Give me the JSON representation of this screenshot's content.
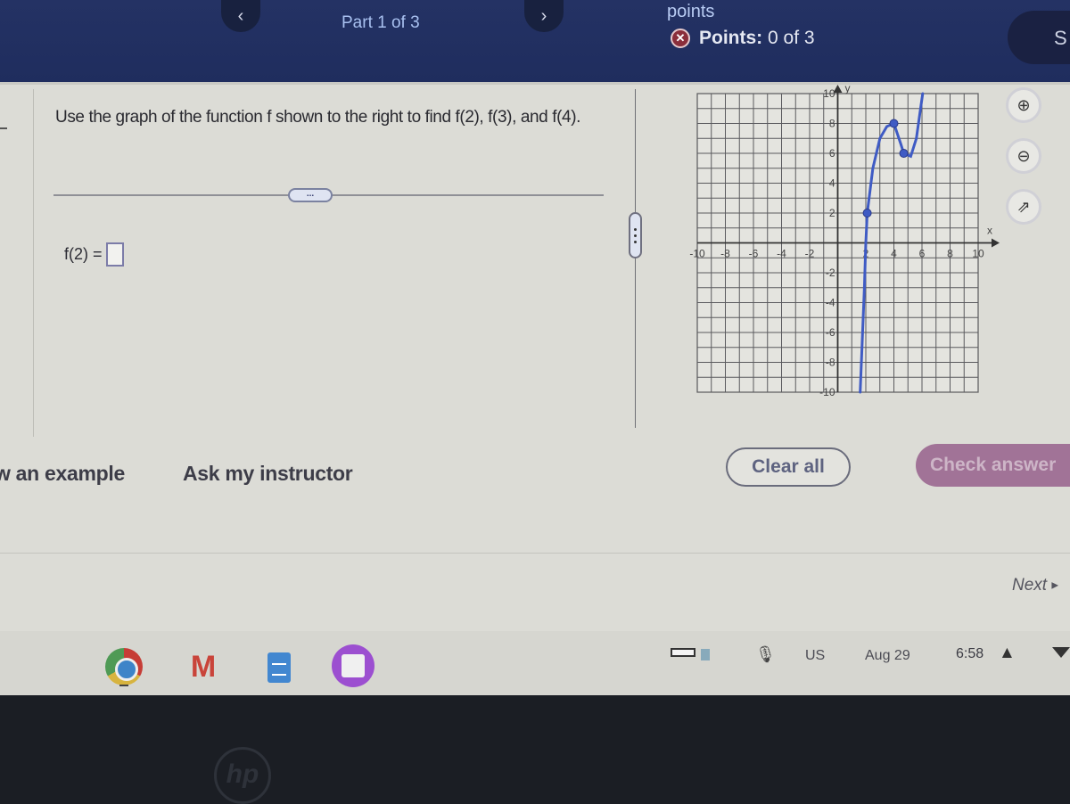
{
  "header": {
    "prev_icon": "chevron-left",
    "next_icon": "chevron-right",
    "part_label": "Part 1 of 3",
    "points_caption": "points",
    "points_status_icon": "x-circle",
    "points_label": "Points:",
    "points_value": "0 of 3",
    "save_label": "S"
  },
  "question": {
    "text": "Use the graph of the function f shown to the right to find f(2), f(3), and f(4).",
    "more_label": "...",
    "answer_label": "f(2) =",
    "answer_value": ""
  },
  "graph": {
    "x_label": "x",
    "y_label": "y",
    "x_ticks": [
      "-10",
      "-8",
      "-6",
      "-4",
      "-2",
      "2",
      "4",
      "6",
      "8",
      "10"
    ],
    "y_ticks": [
      "10",
      "8",
      "6",
      "4",
      "2",
      "-2",
      "-4",
      "-6",
      "-8",
      "-10"
    ],
    "x_range": [
      -10,
      10
    ],
    "y_range": [
      -10,
      10
    ],
    "curve_color": "#3f5bc4",
    "curve_points": [
      [
        1.6,
        -10
      ],
      [
        1.9,
        -3
      ],
      [
        2,
        0
      ],
      [
        2.1,
        2
      ],
      [
        2.5,
        5
      ],
      [
        3,
        7
      ],
      [
        3.5,
        7.8
      ],
      [
        4,
        8
      ],
      [
        4.5,
        6.6
      ],
      [
        4.7,
        6
      ],
      [
        5.2,
        5.8
      ],
      [
        5.6,
        7
      ],
      [
        5.9,
        9
      ],
      [
        6.05,
        10
      ]
    ],
    "marked_points": [
      [
        2.1,
        2
      ],
      [
        4,
        8
      ],
      [
        4.7,
        6
      ]
    ]
  },
  "tools": {
    "zoom_in": "zoom-in",
    "zoom_out": "zoom-out",
    "popout": "open-external"
  },
  "actions": {
    "example_label": "w an example",
    "instructor_label": "Ask my instructor",
    "clear_label": "Clear all",
    "check_label": "Check answer",
    "next_label": "Next",
    "next_arrow": "▶"
  },
  "shelf": {
    "apps": [
      "Chrome",
      "Gmail",
      "Docs",
      "Canvas"
    ],
    "ime": "US",
    "date": "Aug 29",
    "time": "6:58",
    "mic_glyph": "🎙",
    "warning_glyph": "▲"
  },
  "brand": "hp"
}
